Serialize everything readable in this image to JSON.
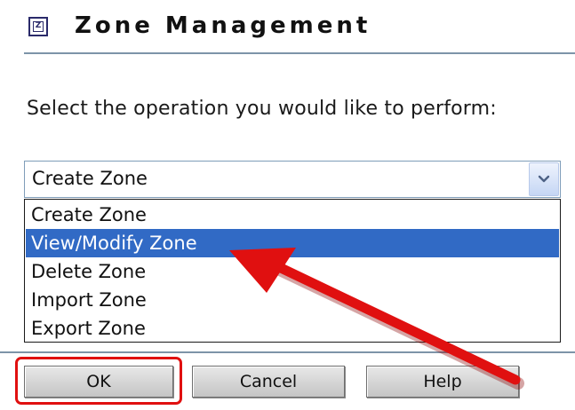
{
  "header": {
    "title": "Zone Management",
    "icon": "zone-icon",
    "icon_glyph": "Z"
  },
  "prompt": "Select the operation you would like to perform:",
  "operation_select": {
    "selected_value": "Create Zone",
    "options": [
      "Create Zone",
      "View/Modify Zone",
      "Delete Zone",
      "Import Zone",
      "Export Zone"
    ],
    "highlighted_option": "View/Modify Zone"
  },
  "buttons": {
    "ok": "OK",
    "cancel": "Cancel",
    "help": "Help"
  },
  "colors": {
    "accent_rule": "#7d94a8",
    "selection": "#316ac5",
    "annotation": "#e01010"
  }
}
